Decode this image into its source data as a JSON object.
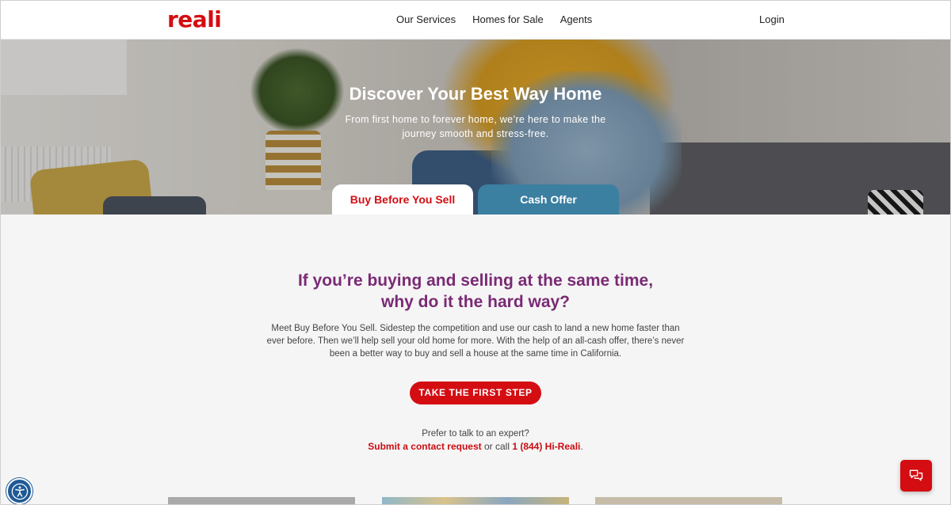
{
  "header": {
    "logo": "reali",
    "nav": [
      "Our Services",
      "Homes for Sale",
      "Agents"
    ],
    "login": "Login"
  },
  "hero": {
    "title": "Discover Your Best Way Home",
    "subtitle": "From first home to forever home, we’re here to make the journey smooth and stress-free.",
    "tabs": [
      {
        "label": "Buy Before You Sell",
        "active": true
      },
      {
        "label": "Cash Offer",
        "active": false
      }
    ]
  },
  "main": {
    "headline_line1": "If you’re buying and selling at the same time,",
    "headline_line2": "why do it the hard way?",
    "body": "Meet Buy Before You Sell. Sidestep the competition and use our cash to land a new home faster than ever before. Then we’ll help sell your old home for more. With the help of an all-cash offer, there’s never been a better way to buy and sell a house at the same time in California.",
    "cta": "TAKE THE FIRST STEP",
    "expert_question": "Prefer to talk to an expert?",
    "contact_link": "Submit a contact request",
    "or_call": " or call ",
    "phone": "1 (844) Hi-Reali",
    "period": "."
  },
  "floating": {
    "accessibility_icon": "accessibility-icon",
    "chat_icon": "chat-icon"
  },
  "colors": {
    "brand_red": "#d40d12",
    "headline_purple": "#7a2a74",
    "cash_tab_blue": "#3b7fa1",
    "a11y_blue": "#1f5a96"
  }
}
